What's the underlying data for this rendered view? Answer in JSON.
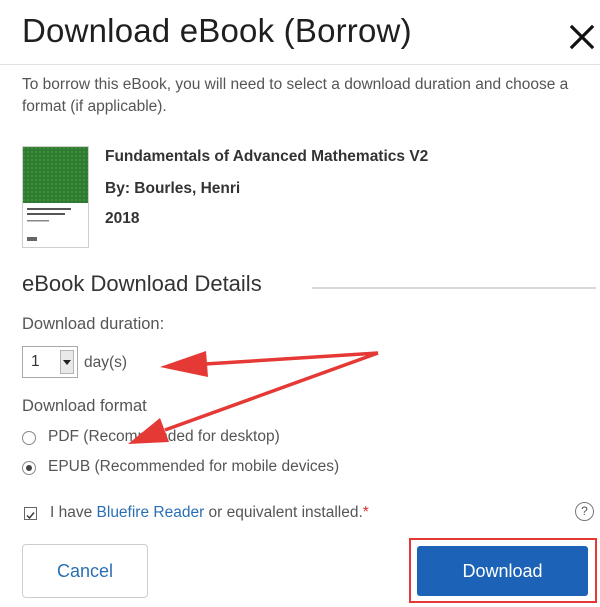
{
  "dialog": {
    "title": "Download eBook (Borrow)",
    "intro": "To borrow this eBook, you will need to select a download duration and choose a format (if applicable)."
  },
  "book": {
    "title": "Fundamentals of Advanced Mathematics V2",
    "author": "By: Bourles, Henri",
    "year": "2018",
    "cover_text": "Fundamentals of Advanced Mathematics 2",
    "cover_author": "Henri Bourles",
    "cover_color": "#2e7d32"
  },
  "details": {
    "heading": "eBook Download Details",
    "duration_label": "Download duration:",
    "duration_value": "1",
    "duration_unit": "day(s)",
    "format_label": "Download format",
    "formats": [
      {
        "label": "PDF (Recommended for desktop)",
        "selected": false
      },
      {
        "label": "EPUB (Recommended for mobile devices)",
        "selected": true
      }
    ],
    "confirm": {
      "prefix": "I have ",
      "link": "Bluefire Reader",
      "suffix": " or equivalent installed.",
      "required_mark": "*",
      "checked": true
    }
  },
  "actions": {
    "cancel_label": "Cancel",
    "download_label": "Download"
  },
  "colors": {
    "primary": "#1c63b7",
    "link": "#2a6fb3",
    "annotation": "#e53935"
  },
  "icons": {
    "close": "close-icon",
    "help": "help-icon",
    "select": "chevron-down-icon"
  },
  "help_glyph": "?"
}
